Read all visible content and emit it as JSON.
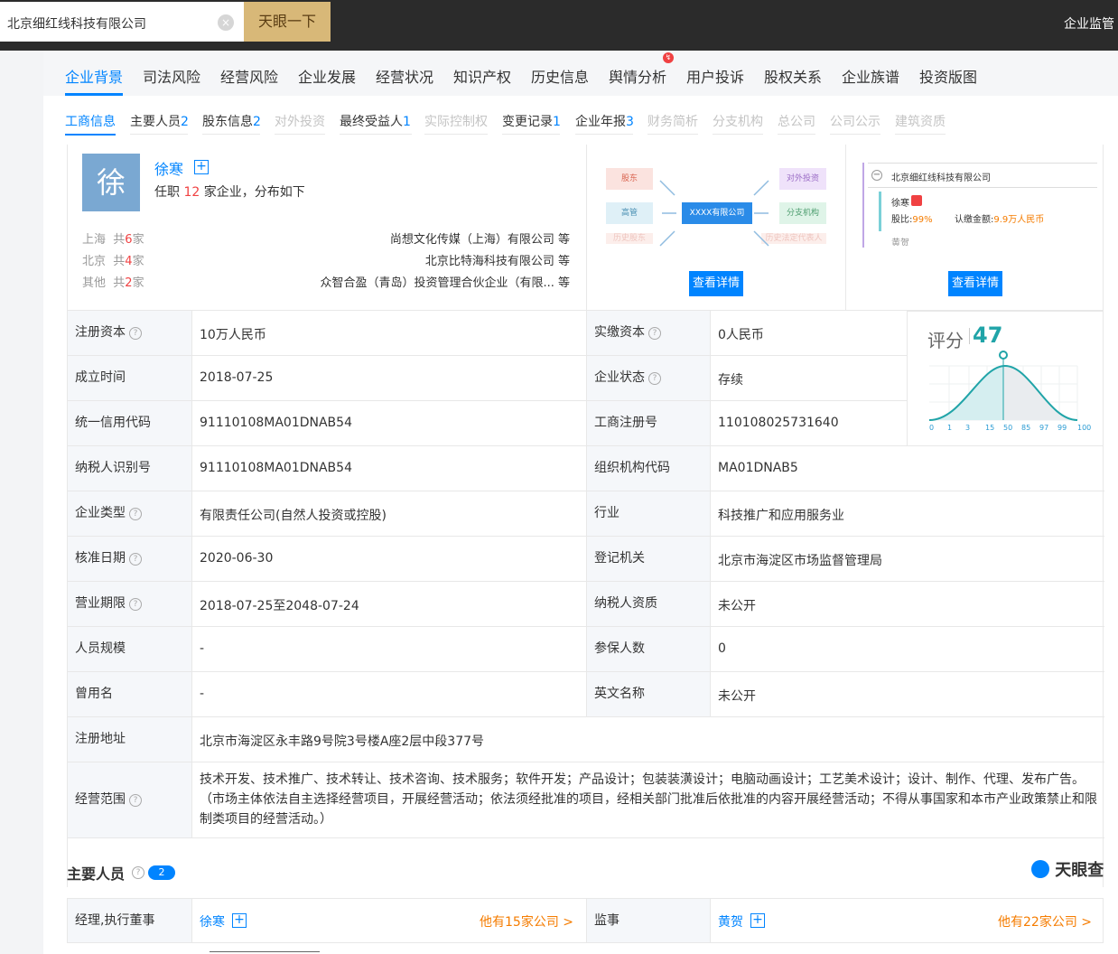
{
  "search": {
    "value": "北京细红线科技有限公司",
    "button": "天眼一下",
    "clear": "×"
  },
  "top_right": "企业监管",
  "main_tabs": [
    "企业背景",
    "司法风险",
    "经营风险",
    "企业发展",
    "经营状况",
    "知识产权",
    "历史信息",
    "舆情分析",
    "用户投诉",
    "股权关系",
    "企业族谱",
    "投资版图"
  ],
  "main_tabs_badge": "↯",
  "sub_tabs": [
    {
      "label": "工商信息",
      "count": ""
    },
    {
      "label": "主要人员",
      "count": "2"
    },
    {
      "label": "股东信息",
      "count": "2"
    },
    {
      "label": "对外投资",
      "count": ""
    },
    {
      "label": "最终受益人",
      "count": "1"
    },
    {
      "label": "实际控制权",
      "count": ""
    },
    {
      "label": "变更记录",
      "count": "1"
    },
    {
      "label": "企业年报",
      "count": "3"
    },
    {
      "label": "财务简析",
      "count": ""
    },
    {
      "label": "分支机构",
      "count": ""
    },
    {
      "label": "总公司",
      "count": ""
    },
    {
      "label": "公司公示",
      "count": ""
    },
    {
      "label": "建筑资质",
      "count": ""
    }
  ],
  "person": {
    "avatar": "徐",
    "name": "徐寒",
    "plus": "+",
    "desc_prefix": "任职",
    "count": "12",
    "desc_suffix": "家企业，分布如下",
    "regions": [
      {
        "city": "上海",
        "pre": "共",
        "num": "6",
        "post": "家",
        "company": "尚想文化传媒（上海）有限公司 等"
      },
      {
        "city": "北京",
        "pre": "共",
        "num": "4",
        "post": "家",
        "company": "北京比特海科技有限公司 等"
      },
      {
        "city": "其他",
        "pre": "共",
        "num": "2",
        "post": "家",
        "company": "众智合盈（青岛）投资管理合伙企业（有限... 等"
      }
    ]
  },
  "diagram1": {
    "boxes": [
      "股东",
      "高管",
      "XXXX有限公司",
      "对外投资",
      "分支机构",
      "历史股东",
      "历史法定代表人"
    ],
    "button": "查看详情"
  },
  "diagram2": {
    "company": "北京细红线科技有限公司",
    "person": "徐寒",
    "ratio_label": "股比:",
    "ratio": "99%",
    "amount_label": "认缴金额:",
    "amount": "9.9万人民币",
    "next": "黄贺",
    "button": "查看详情",
    "minus": "−"
  },
  "table": [
    {
      "l1": "注册资本",
      "q1": true,
      "v1": "10万人民币",
      "l2": "实缴资本",
      "q2": true,
      "v2": "0人民币"
    },
    {
      "l1": "成立时间",
      "q1": false,
      "v1": "2018-07-25",
      "l2": "企业状态",
      "q2": true,
      "v2": "存续"
    },
    {
      "l1": "统一信用代码",
      "q1": false,
      "v1": "91110108MA01DNAB54",
      "l2": "工商注册号",
      "q2": false,
      "v2": "110108025731640"
    },
    {
      "l1": "纳税人识别号",
      "q1": false,
      "v1": "91110108MA01DNAB54",
      "l2": "组织机构代码",
      "q2": false,
      "v2": "MA01DNAB5"
    },
    {
      "l1": "企业类型",
      "q1": true,
      "v1": "有限责任公司(自然人投资或控股)",
      "l2": "行业",
      "q2": false,
      "v2": "科技推广和应用服务业"
    },
    {
      "l1": "核准日期",
      "q1": true,
      "v1": "2020-06-30",
      "l2": "登记机关",
      "q2": false,
      "v2": "北京市海淀区市场监督管理局"
    },
    {
      "l1": "营业期限",
      "q1": true,
      "v1": "2018-07-25至2048-07-24",
      "l2": "纳税人资质",
      "q2": false,
      "v2": "未公开"
    },
    {
      "l1": "人员规模",
      "q1": false,
      "v1": "-",
      "l2": "参保人数",
      "q2": false,
      "v2": "0"
    },
    {
      "l1": "曾用名",
      "q1": false,
      "v1": "-",
      "l2": "英文名称",
      "q2": false,
      "v2": "未公开"
    }
  ],
  "address": {
    "label": "注册地址",
    "value": "北京市海淀区永丰路9号院3号楼A座2层中段377号"
  },
  "scope": {
    "label": "经营范围",
    "lines": [
      "技术开发、技术推广、技术转让、技术咨询、技术服务；软件开发；产品设计；包装装潢设计；电脑动画设计；工艺美术设计；设计、制作、代理、发布广告。",
      "（市场主体依法自主选择经营项目，开展经营活动；依法须经批准的项目，经相关部门批准后依批准的内容开展经营活动；不得从事国家和本市产业政策禁止和限",
      "制类项目的经营活动。）"
    ]
  },
  "score": {
    "label": "评分",
    "value": "47",
    "ticks": [
      "0",
      "1",
      "3",
      "15",
      "50",
      "85",
      "97",
      "99",
      "100"
    ]
  },
  "key_people": {
    "title": "主要人员",
    "count": "2",
    "logo": "天眼查",
    "rows": [
      {
        "role": "经理,执行董事",
        "name": "徐寒",
        "more": "他有15家公司 >"
      },
      {
        "role": "监事",
        "name": "黄贺",
        "more": "他有22家公司 >"
      }
    ]
  },
  "colors": {
    "accent": "#0084ff",
    "danger": "#f04142",
    "gold": "#d8b878",
    "orange": "#f57c00"
  }
}
